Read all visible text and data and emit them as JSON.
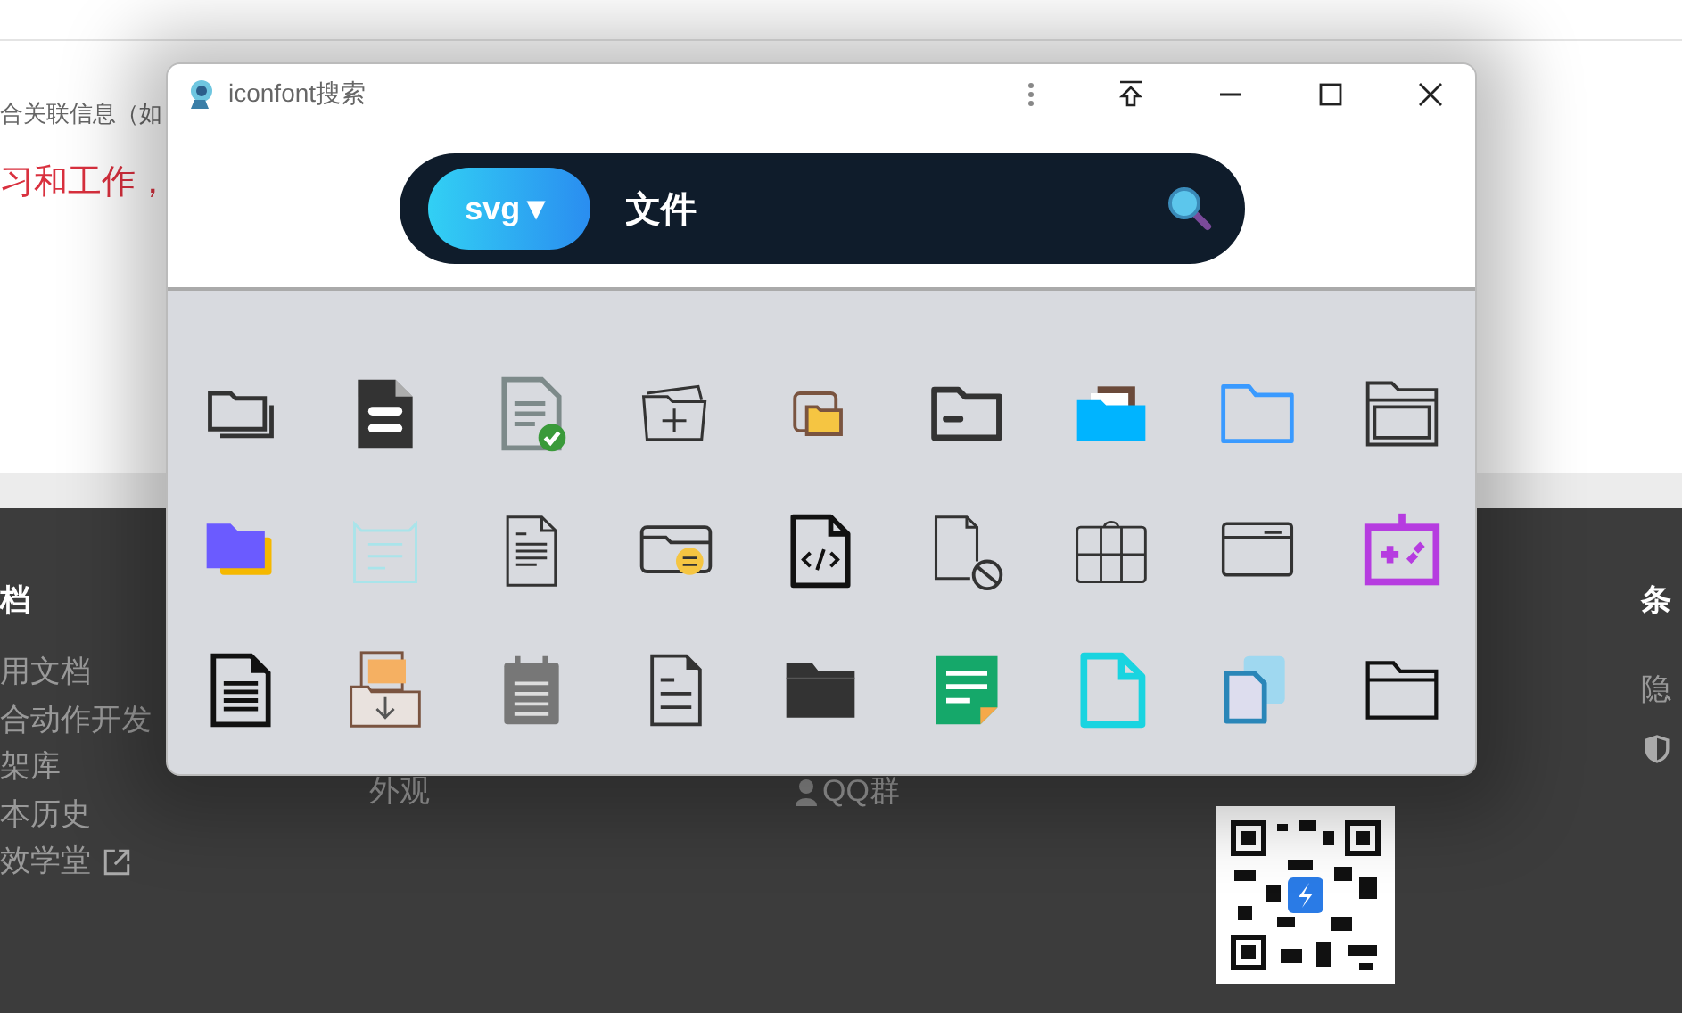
{
  "window": {
    "title": "iconfont搜索"
  },
  "search": {
    "type_button": "svg▼",
    "value": "文件"
  },
  "background_page": {
    "top_texts": [
      "合关联信息（如",
      "习和工作，"
    ],
    "footer": {
      "left_heading": "档",
      "left_links": [
        "用文档",
        "合动作开发",
        "架库",
        "本历史",
        "效学堂"
      ],
      "middle_link": "外观",
      "community_link": "QQ群",
      "right_heading": "条",
      "right_link": "隐"
    }
  }
}
